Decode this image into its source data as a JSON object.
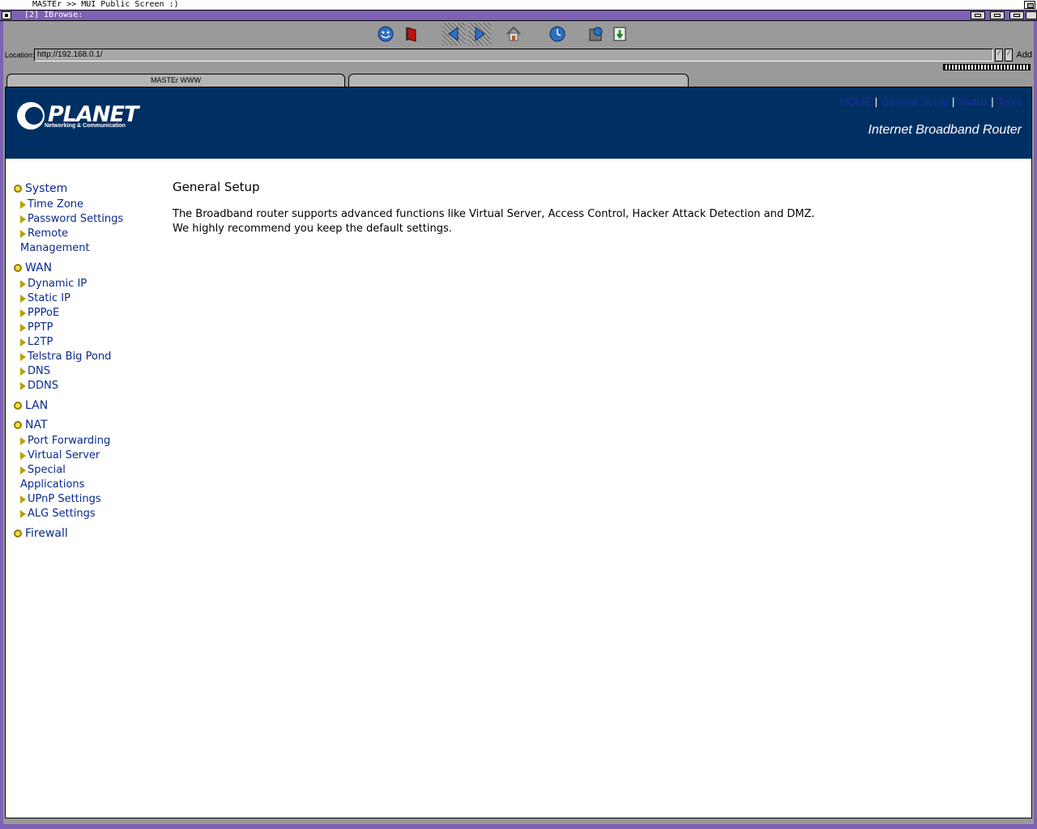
{
  "screen": {
    "title": "MASTEr >> MUI Public Screen :)"
  },
  "window": {
    "title": "[2] IBrowse:"
  },
  "location": {
    "label": "Location:",
    "url": "http://192.168.0.1/",
    "add_label": "Add"
  },
  "tabs": [
    {
      "label": "MASTEr WWW"
    },
    {
      "label": ""
    }
  ],
  "banner": {
    "brand": "PLANET",
    "tagline": "Networking & Communication",
    "product": "Internet Broadband Router",
    "links": [
      {
        "label": "HOME"
      },
      {
        "label": "General Setup"
      },
      {
        "label": "Status"
      },
      {
        "label": "Tools"
      }
    ]
  },
  "sidebar": {
    "system": {
      "label": "System",
      "items": [
        "Time Zone",
        "Password Settings",
        "Remote Management"
      ]
    },
    "wan": {
      "label": "WAN",
      "items": [
        "Dynamic IP",
        "Static IP",
        "PPPoE",
        "PPTP",
        "L2TP",
        "Telstra Big Pond",
        "DNS",
        "DDNS"
      ]
    },
    "lan": {
      "label": "LAN"
    },
    "nat": {
      "label": "NAT",
      "items": [
        "Port Forwarding",
        "Virtual Server",
        "Special Applications",
        "UPnP Settings",
        "ALG Settings"
      ]
    },
    "firewall": {
      "label": "Firewall"
    }
  },
  "main": {
    "title": "General Setup",
    "line1": "The Broadband router supports advanced functions like Virtual Server, Access Control, Hacker Attack Detection and DMZ.",
    "line2": "We highly recommend you keep the default settings."
  },
  "colors": {
    "banner": "#003063",
    "window_border": "#7d62b5",
    "link": "#0a2a8c"
  },
  "toolbar_icons": [
    "smiley-icon",
    "stop-icon",
    "back-icon",
    "forward-icon",
    "home-icon",
    "reload-icon",
    "save-icon",
    "download-icon"
  ]
}
